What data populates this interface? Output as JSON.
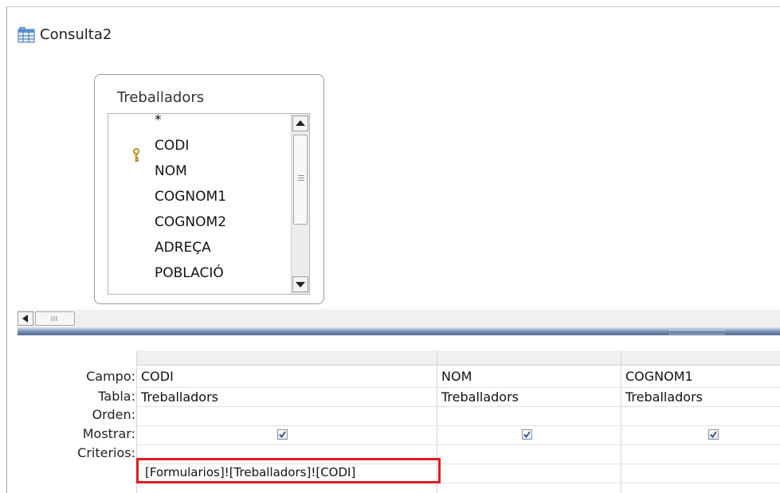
{
  "window": {
    "title": "Consulta2"
  },
  "table_box": {
    "title": "Treballadors",
    "fields": [
      "*",
      "CODI",
      "NOM",
      "COGNOM1",
      "COGNOM2",
      "ADREÇA",
      "POBLACIÓ"
    ]
  },
  "grid": {
    "row_labels": {
      "campo": "Campo:",
      "tabla": "Tabla:",
      "orden": "Orden:",
      "mostrar": "Mostrar:",
      "criterios": "Criterios:"
    },
    "columns": [
      {
        "campo": "CODI",
        "tabla": "Treballadors",
        "orden": "",
        "mostrar": true,
        "criterios": "[Formularios]![Treballadors]![CODI]"
      },
      {
        "campo": "NOM",
        "tabla": "Treballadors",
        "orden": "",
        "mostrar": true,
        "criterios": ""
      },
      {
        "campo": "COGNOM1",
        "tabla": "Treballadors",
        "orden": "",
        "mostrar": true,
        "criterios": ""
      }
    ]
  },
  "colors": {
    "highlight": "#e01c23",
    "splitter": "#4d6a94"
  }
}
